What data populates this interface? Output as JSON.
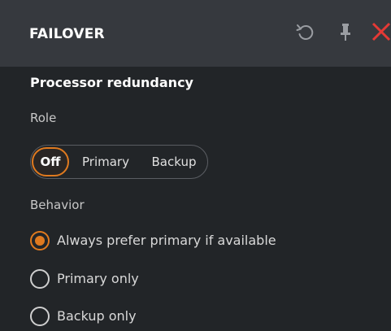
{
  "panel": {
    "title": "FAILOVER",
    "icons": {
      "reset": "reset-icon",
      "pin": "pin-icon",
      "close": "close-icon"
    }
  },
  "section": {
    "title": "Processor redundancy"
  },
  "role": {
    "label": "Role",
    "options": [
      "Off",
      "Primary",
      "Backup"
    ],
    "selected": "Off"
  },
  "behavior": {
    "label": "Behavior",
    "options": [
      "Always prefer primary if available",
      "Primary only",
      "Backup only"
    ],
    "selected": "Always prefer primary if available"
  },
  "colors": {
    "accent": "#e07a1f",
    "close": "#e53935",
    "panel_bg": "#222528",
    "header_bg": "#36393e"
  }
}
